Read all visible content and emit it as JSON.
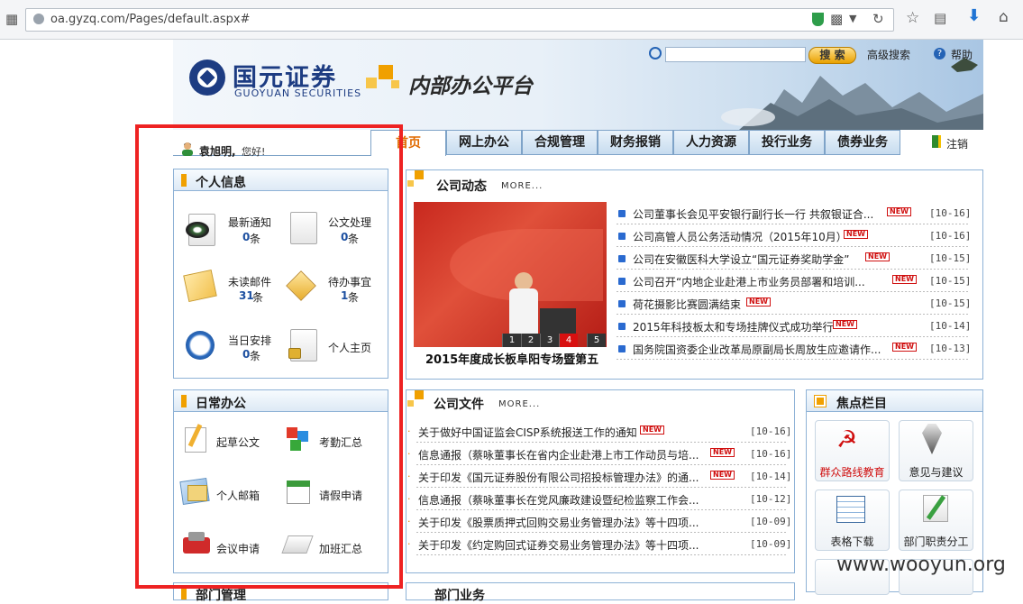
{
  "browser": {
    "url": "oa.gyzq.com/Pages/default.aspx#"
  },
  "header": {
    "logo_cn": "国元证券",
    "logo_en": "GUOYUAN SECURITIES",
    "platform_title": "内部办公平台",
    "search_placeholder": "",
    "search_label": "搜 索",
    "advanced_search": "高级搜索",
    "help": "帮助"
  },
  "nav": {
    "username": "袁旭明,",
    "greeting": "您好!",
    "tabs": [
      "首页",
      "网上办公",
      "合规管理",
      "财务报销",
      "人力资源",
      "投行业务",
      "债券业务"
    ],
    "active_tab": "首页",
    "logout": "注销"
  },
  "personal_info": {
    "title": "个人信息",
    "items": [
      {
        "label": "最新通知",
        "count": "0",
        "unit": "条",
        "icon": "notice-icon"
      },
      {
        "label": "公文处理",
        "count": "0",
        "unit": "条",
        "icon": "document-icon"
      },
      {
        "label": "未读邮件",
        "count": "31",
        "unit": "条",
        "icon": "mail-icon"
      },
      {
        "label": "待办事宜",
        "count": "1",
        "unit": "条",
        "icon": "todo-icon"
      },
      {
        "label": "当日安排",
        "count": "0",
        "unit": "条",
        "icon": "clock-icon"
      },
      {
        "label": "个人主页",
        "count": "",
        "unit": "",
        "icon": "lock-page-icon"
      }
    ]
  },
  "daily_office": {
    "title": "日常办公",
    "items": [
      {
        "label": "起草公文",
        "icon": "pencil-icon"
      },
      {
        "label": "考勤汇总",
        "icon": "cubes-icon"
      },
      {
        "label": "个人邮箱",
        "icon": "mailbox-icon"
      },
      {
        "label": "请假申请",
        "icon": "calendar-icon"
      },
      {
        "label": "会议申请",
        "icon": "meeting-icon"
      },
      {
        "label": "加班汇总",
        "icon": "papers-icon"
      }
    ]
  },
  "company_news": {
    "title": "公司动态",
    "more": "MORE...",
    "photo_caption": "2015年度成长板阜阳专场暨第五",
    "pager": [
      "1",
      "2",
      "3",
      "4",
      "5"
    ],
    "pager_active": "4",
    "items": [
      {
        "text": "公司董事长会见平安银行副行长一行 共叙银证合...",
        "new": true,
        "date": "[10-16]"
      },
      {
        "text": "公司高管人员公务活动情况（2015年10月）",
        "new": true,
        "date": "[10-16]"
      },
      {
        "text": "公司在安徽医科大学设立“国元证券奖助学金”",
        "new": true,
        "date": "[10-15]"
      },
      {
        "text": "公司召开“内地企业赴港上市业务员部署和培训...",
        "new": true,
        "date": "[10-15]"
      },
      {
        "text": "荷花摄影比赛圆满结束",
        "new": true,
        "date": "[10-15]"
      },
      {
        "text": "2015年科技板太和专场挂牌仪式成功举行",
        "new": true,
        "date": "[10-14]"
      },
      {
        "text": "国务院国资委企业改革局原副局长周放生应邀请作...",
        "new": true,
        "date": "[10-13]"
      }
    ],
    "new_label": "NEW"
  },
  "company_files": {
    "title": "公司文件",
    "more": "MORE...",
    "items": [
      {
        "text": "关于做好中国证监会CISP系统报送工作的通知",
        "new": true,
        "date": "[10-16]"
      },
      {
        "text": "信息通报（蔡咏董事长在省内企业赴港上市工作动员与培...",
        "new": true,
        "date": "[10-16]"
      },
      {
        "text": "关于印发《国元证券股份有限公司招投标管理办法》的通...",
        "new": true,
        "date": "[10-14]"
      },
      {
        "text": "信息通报（蔡咏董事长在党风廉政建设暨纪检监察工作会...",
        "new": false,
        "date": "[10-12]"
      },
      {
        "text": "关于印发《股票质押式回购交易业务管理办法》等十四项...",
        "new": false,
        "date": "[10-09]"
      },
      {
        "text": "关于印发《约定购回式证券交易业务管理办法》等十四项...",
        "new": false,
        "date": "[10-09]"
      }
    ]
  },
  "focus": {
    "title": "焦点栏目",
    "tiles": [
      {
        "label": "群众路线教育",
        "icon": "hammer-sickle-icon",
        "color": "#d01010"
      },
      {
        "label": "意见与建议",
        "icon": "pen-nib-icon",
        "color": "#222222"
      },
      {
        "label": "表格下载",
        "icon": "table-icon",
        "color": "#222222"
      },
      {
        "label": "部门职责分工",
        "icon": "edit-icon",
        "color": "#222222"
      }
    ]
  },
  "bottom_panels": {
    "left_title": "部门管理",
    "right_title": "部门业务"
  },
  "watermark": "www.wooyun.org",
  "colors": {
    "accent_orange": "#f0a000",
    "nav_blue": "#7ea3c8",
    "highlight_red": "#ee2222",
    "count_blue": "#1c4fa0"
  }
}
